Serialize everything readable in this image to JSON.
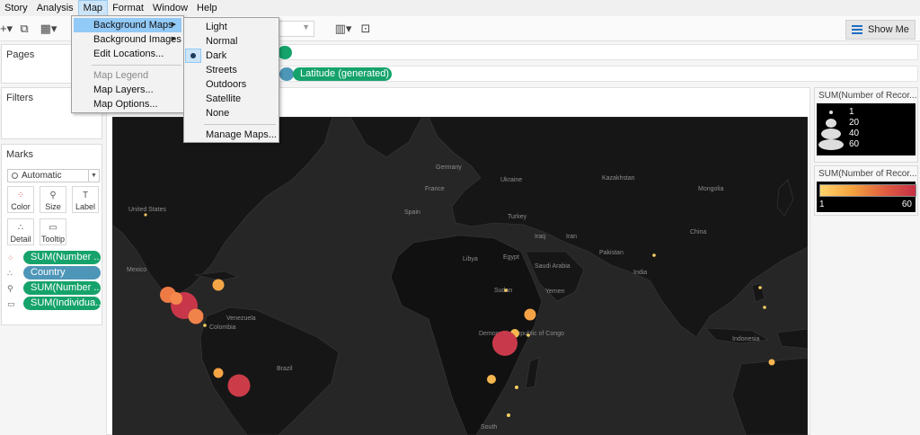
{
  "menubar": {
    "items": [
      "Story",
      "Analysis",
      "Map",
      "Format",
      "Window",
      "Help"
    ],
    "active": "Map"
  },
  "toolbar": {
    "show_me_label": "Show Me"
  },
  "shelves": {
    "columns_pill": "",
    "rows_pills": [
      "",
      "Latitude (generated)"
    ]
  },
  "panels": {
    "pages_title": "Pages",
    "filters_title": "Filters",
    "marks_title": "Marks",
    "mark_type": "Automatic",
    "mark_buttons": [
      "Color",
      "Size",
      "Label",
      "Detail",
      "Tooltip"
    ],
    "mark_fields": [
      {
        "label": "SUM(Number ..",
        "color": "green",
        "icon": "color-icon"
      },
      {
        "label": "Country",
        "color": "blue",
        "icon": "detail-icon"
      },
      {
        "label": "SUM(Number ..",
        "color": "green",
        "icon": "size-icon"
      },
      {
        "label": "SUM(Individua..",
        "color": "green",
        "icon": "tooltip-icon"
      }
    ]
  },
  "map_menu": {
    "items": [
      {
        "label": "Background Maps",
        "highlighted": true,
        "submenu": true
      },
      {
        "label": "Background Images",
        "submenu": true
      },
      {
        "label": "Edit Locations..."
      },
      {
        "label": "Map Legend",
        "disabled": true
      },
      {
        "label": "Map Layers..."
      },
      {
        "label": "Map Options..."
      }
    ]
  },
  "background_maps_menu": {
    "items": [
      "Light",
      "Normal",
      "Dark",
      "Streets",
      "Outdoors",
      "Satellite",
      "None",
      "Manage Maps..."
    ],
    "selected": "Dark"
  },
  "map_labels": [
    "Germany",
    "France",
    "Spain",
    "Ukraine",
    "Kazakhstan",
    "Mongolia",
    "Turkey",
    "Iran",
    "Iraq",
    "Libya",
    "Egypt",
    "Saudi Arabia",
    "Sudan",
    "Yemen",
    "Pakistan",
    "India",
    "China",
    "Indonesia",
    "United States",
    "Mexico",
    "Venezuela",
    "Colombia",
    "Brazil",
    "Democratic Republic of Congo",
    "South"
  ],
  "legends": {
    "size_title": "SUM(Number of Recor...",
    "size_values": [
      "1",
      "20",
      "40",
      "60"
    ],
    "color_title": "SUM(Number of Recor...",
    "color_min": "1",
    "color_max": "60",
    "color_range": [
      "#ffd36b",
      "#c72f45"
    ]
  }
}
